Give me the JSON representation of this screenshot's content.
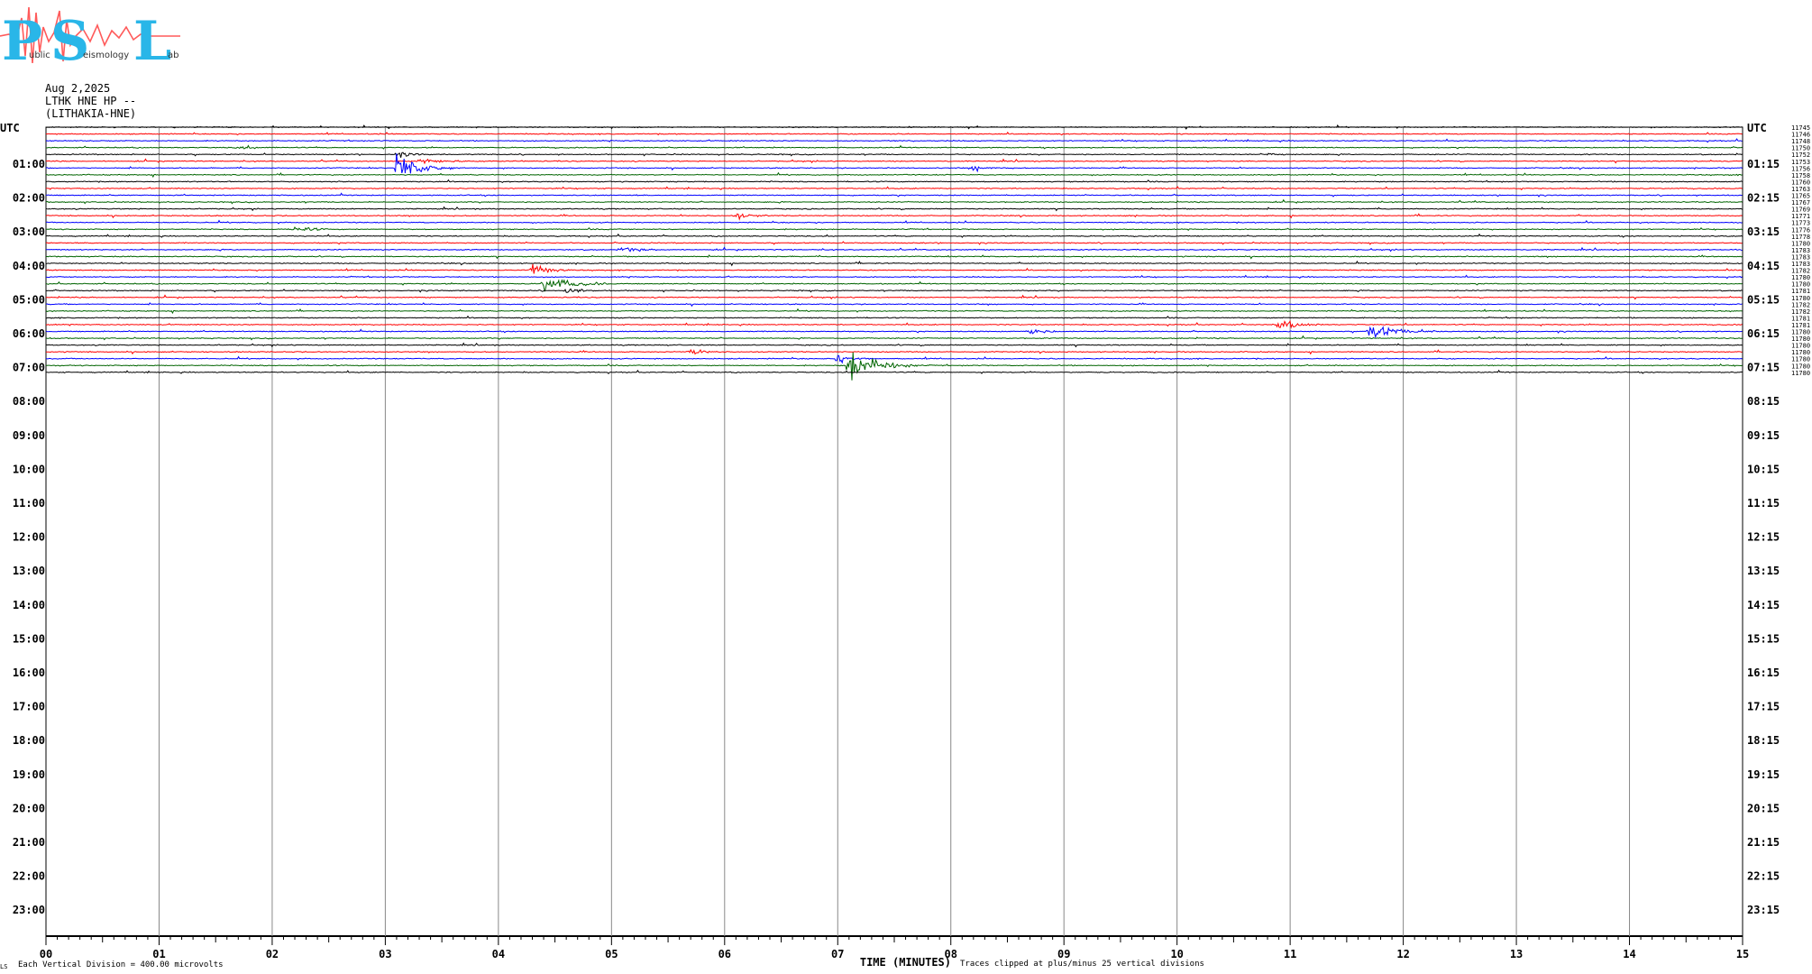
{
  "logo": {
    "letters": [
      "P",
      "S",
      "L"
    ],
    "small_words": [
      "ublic",
      "eismology",
      "ab"
    ],
    "text_color": "#29b6e8",
    "wave_color": "#ff5a5a"
  },
  "header": {
    "date": "Aug 2,2025",
    "station": "LTHK HNE HP --",
    "location": "(LITHAKIA-HNE)"
  },
  "footer": {
    "scale_prefix": "LS",
    "scale_note": "Each Vertical Division =  400.00 microvolts",
    "xlabel": "TIME (MINUTES)",
    "clip_note": "Traces clipped at plus/minus 25 vertical divisions"
  },
  "chart_data": {
    "type": "line",
    "title": "",
    "xlabel": "TIME (MINUTES)",
    "ylabel": "UTC",
    "xlim": [
      0,
      15
    ],
    "x_ticks": [
      "00",
      "01",
      "02",
      "03",
      "04",
      "05",
      "06",
      "07",
      "08",
      "09",
      "10",
      "11",
      "12",
      "13",
      "14",
      "15"
    ],
    "left_hour_labels": [
      "UTC",
      "01:00",
      "02:00",
      "03:00",
      "04:00",
      "05:00",
      "06:00",
      "07:00",
      "08:00",
      "09:00",
      "10:00",
      "11:00",
      "12:00",
      "13:00",
      "14:00",
      "15:00",
      "16:00",
      "17:00",
      "18:00",
      "19:00",
      "20:00",
      "21:00",
      "22:00",
      "23:00"
    ],
    "right_labels": [
      "UTC",
      "01:15",
      "02:15",
      "03:15",
      "04:15",
      "05:15",
      "06:15",
      "07:15",
      "08:15",
      "09:15",
      "10:15",
      "11:15",
      "12:15",
      "13:15",
      "14:15",
      "15:15",
      "16:15",
      "17:15",
      "18:15",
      "19:15",
      "20:15",
      "21:15",
      "22:15",
      "23:15"
    ],
    "trace_colors": [
      "#000000",
      "#ff0000",
      "#0000ff",
      "#006400"
    ],
    "trace_offsets": [
      11745,
      11746,
      11748,
      11750,
      11752,
      11753,
      11756,
      11758,
      11760,
      11763,
      11765,
      11767,
      11769,
      11771,
      11773,
      11776,
      11778,
      11780,
      11783,
      11783,
      11783,
      11782,
      11780,
      11780,
      11781,
      11780,
      11782,
      11782,
      11781,
      11781,
      11780,
      11780,
      11780,
      11780,
      11780,
      11780,
      11780
    ],
    "events": [
      {
        "trace": 3,
        "minute": 1.7,
        "amp": 3,
        "dur": 0.4
      },
      {
        "trace": 4,
        "minute": 3.1,
        "amp": 6,
        "dur": 0.3
      },
      {
        "trace": 4,
        "minute": 10.8,
        "amp": 4,
        "dur": 0.3
      },
      {
        "trace": 5,
        "minute": 3.3,
        "amp": 5,
        "dur": 0.5
      },
      {
        "trace": 6,
        "minute": 3.1,
        "amp": 28,
        "dur": 0.5
      },
      {
        "trace": 6,
        "minute": 8.2,
        "amp": 5,
        "dur": 0.3
      },
      {
        "trace": 13,
        "minute": 6.1,
        "amp": 6,
        "dur": 0.3
      },
      {
        "trace": 15,
        "minute": 2.2,
        "amp": 7,
        "dur": 0.3
      },
      {
        "trace": 18,
        "minute": 5.1,
        "amp": 6,
        "dur": 0.3
      },
      {
        "trace": 21,
        "minute": 4.3,
        "amp": 16,
        "dur": 0.3
      },
      {
        "trace": 23,
        "minute": 4.4,
        "amp": 14,
        "dur": 0.6
      },
      {
        "trace": 24,
        "minute": 4.6,
        "amp": 7,
        "dur": 0.3
      },
      {
        "trace": 29,
        "minute": 10.9,
        "amp": 10,
        "dur": 0.4
      },
      {
        "trace": 30,
        "minute": 11.7,
        "amp": 14,
        "dur": 0.6
      },
      {
        "trace": 30,
        "minute": 8.7,
        "amp": 7,
        "dur": 0.3
      },
      {
        "trace": 33,
        "minute": 5.7,
        "amp": 6,
        "dur": 0.3
      },
      {
        "trace": 34,
        "minute": 7.0,
        "amp": 10,
        "dur": 0.3
      },
      {
        "trace": 35,
        "minute": 7.1,
        "amp": 30,
        "dur": 0.6
      }
    ]
  }
}
